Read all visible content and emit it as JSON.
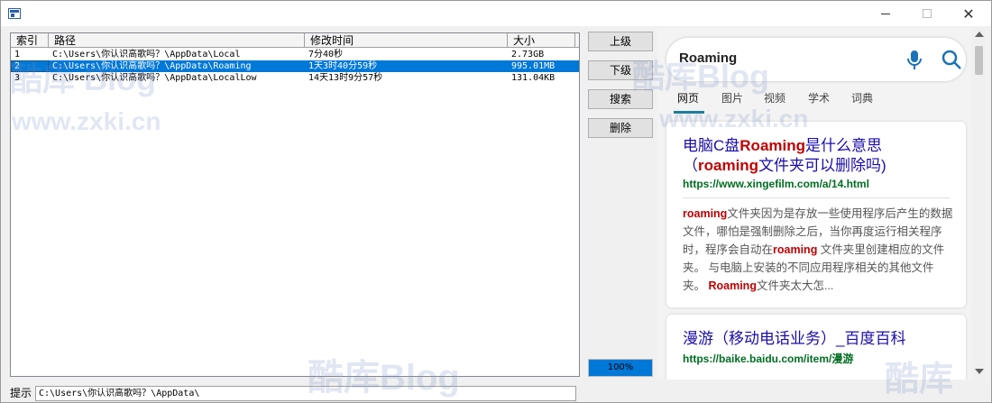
{
  "window": {
    "close_glyph": "✕"
  },
  "listview": {
    "columns": [
      "索引",
      "路径",
      "修改时间",
      "大小"
    ],
    "rows": [
      {
        "index": "1",
        "path": "C:\\Users\\你认识高歌吗？\\AppData\\Local",
        "modified": "7分40秒",
        "size": "2.73GB",
        "selected": false
      },
      {
        "index": "2",
        "path": "C:\\Users\\你认识高歌吗？\\AppData\\Roaming",
        "modified": "1天3时40分59秒",
        "size": "995.01MB",
        "selected": true
      },
      {
        "index": "3",
        "path": "C:\\Users\\你认识高歌吗？\\AppData\\LocalLow",
        "modified": "14天13时9分57秒",
        "size": "131.04KB",
        "selected": false
      }
    ]
  },
  "buttons": {
    "up": "上级",
    "down": "下级",
    "search": "搜索",
    "delete": "删除"
  },
  "progress": {
    "value": 1.0,
    "label": "100%"
  },
  "statusbar": {
    "label": "提示",
    "path": "C:\\Users\\你认识高歌吗？\\AppData\\"
  },
  "browser": {
    "search_query": "Roaming",
    "tabs": [
      "网页",
      "图片",
      "视频",
      "学术",
      "词典"
    ],
    "active_tab": "网页",
    "results": [
      {
        "title_pre": "电脑C盘",
        "title_bold": "Roaming",
        "title_mid": "是什么意思（",
        "title_bold2": "roaming",
        "title_post": "文件夹可以删除吗)",
        "url": "https://www.xingefilm.com/a/14.html",
        "snippet_bold1": "roaming",
        "snippet_part1": "文件夹因为是存放一些使用程序后产生的数据文件，哪怕是强制删除之后，当你再度运行相关程序时，程序会自动在",
        "snippet_bold2": "roaming",
        "snippet_part2": " 文件夹里创建相应的文件夹。 与电脑上安装的不同应用程序相关的其他文件夹。 ",
        "snippet_bold3": "Roaming",
        "snippet_part3": "文件夹太大怎..."
      },
      {
        "title": "漫游（移动电话业务）_百度百科",
        "url": "https://baike.baidu.com/item/漫游"
      }
    ]
  },
  "watermarks": [
    "酷库 Blog",
    "www.zxki.cn",
    "酷库Blog",
    "www.zxki.cn",
    "酷库Blog",
    "酷库"
  ],
  "colors": {
    "selection": "#0078d7",
    "link_title": "#1a0dab",
    "highlight": "#c00000",
    "url_green": "#006d21",
    "tab_underline": "#1f7d9a"
  }
}
